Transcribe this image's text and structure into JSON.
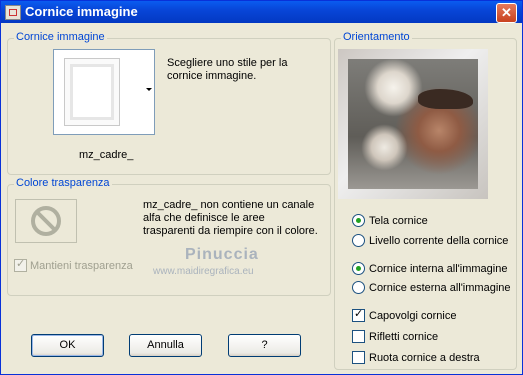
{
  "window": {
    "title": "Cornice immagine",
    "close_glyph": "✕"
  },
  "frame_group": {
    "legend": "Cornice immagine",
    "description": "Scegliere uno stile per la cornice immagine.",
    "selected_frame": "mz_cadre_"
  },
  "transparency_group": {
    "legend": "Colore trasparenza",
    "message": "mz_cadre_ non contiene un canale alfa che definisce le aree trasparenti da riempire con il colore.",
    "keep_transparency": {
      "label": "Mantieni trasparenza",
      "checked": true,
      "disabled": true
    }
  },
  "watermark": {
    "line1": "Pinuccia",
    "line2": "www.maidiregrafica.eu"
  },
  "orientation_group": {
    "legend": "Orientamento",
    "target_options": [
      {
        "label": "Tela cornice",
        "selected": true
      },
      {
        "label": "Livello corrente della cornice",
        "selected": false
      }
    ],
    "placement_options": [
      {
        "label": "Cornice interna all'immagine",
        "selected": true
      },
      {
        "label": "Cornice esterna all'immagine",
        "selected": false
      }
    ],
    "checkboxes": [
      {
        "label": "Capovolgi cornice",
        "checked": true
      },
      {
        "label": "Rifletti cornice",
        "checked": false
      },
      {
        "label": "Ruota cornice a destra",
        "checked": false
      }
    ]
  },
  "buttons": {
    "ok": "OK",
    "cancel": "Annulla",
    "help": "?"
  }
}
